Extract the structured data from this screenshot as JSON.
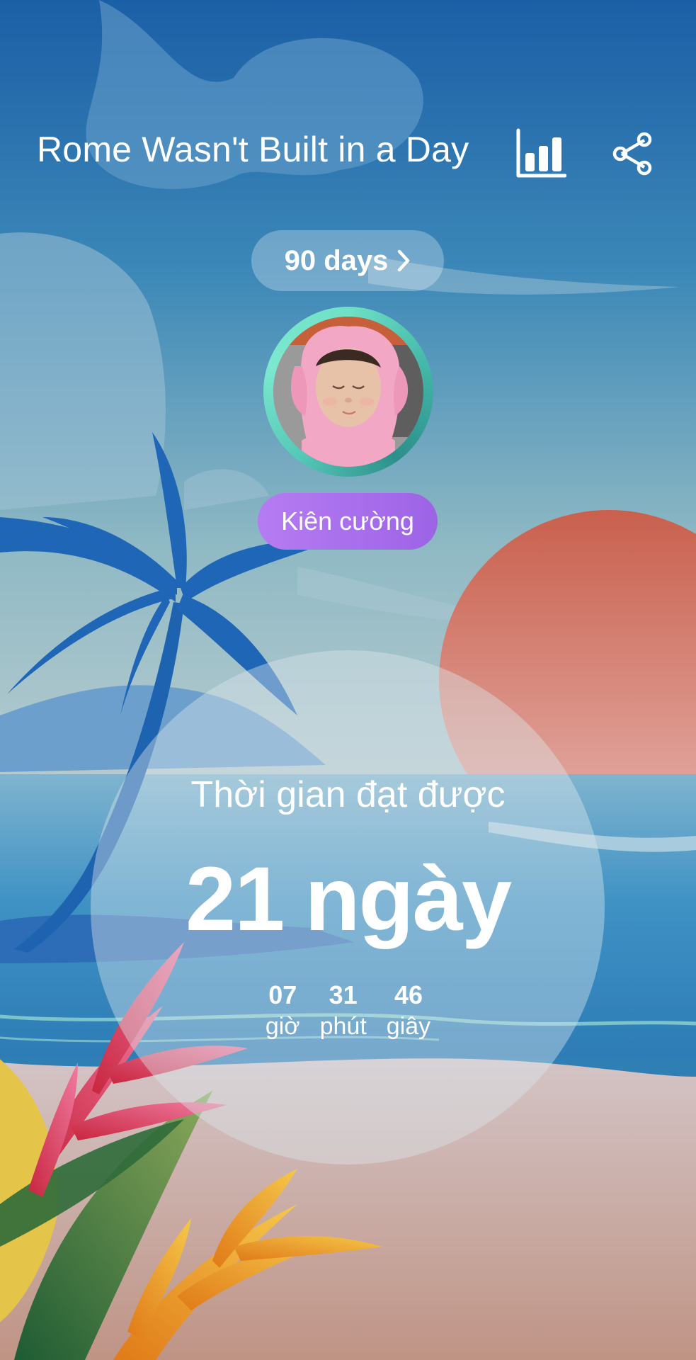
{
  "header": {
    "title": "Rome Wasn't Built in a Day",
    "stats_icon": "bar-chart-icon",
    "share_icon": "share-icon"
  },
  "goal": {
    "days_label": "90 days",
    "chevron_icon": "chevron-right-icon"
  },
  "level": {
    "label": "Kiên cường"
  },
  "progress": {
    "label": "Thời gian đạt được",
    "days_number": "21",
    "days_unit": "ngày",
    "timer": [
      {
        "value": "07",
        "unit": "giờ"
      },
      {
        "value": "31",
        "unit": "phút"
      },
      {
        "value": "46",
        "unit": "giây"
      }
    ]
  },
  "colors": {
    "sky_top": "#1b5fa6",
    "sea": "#3f92c4",
    "sand": "#c8a195",
    "sun": "#d46a55",
    "pill_purple": "#a96ceb",
    "avatar_ring": "#5fd2bd"
  }
}
